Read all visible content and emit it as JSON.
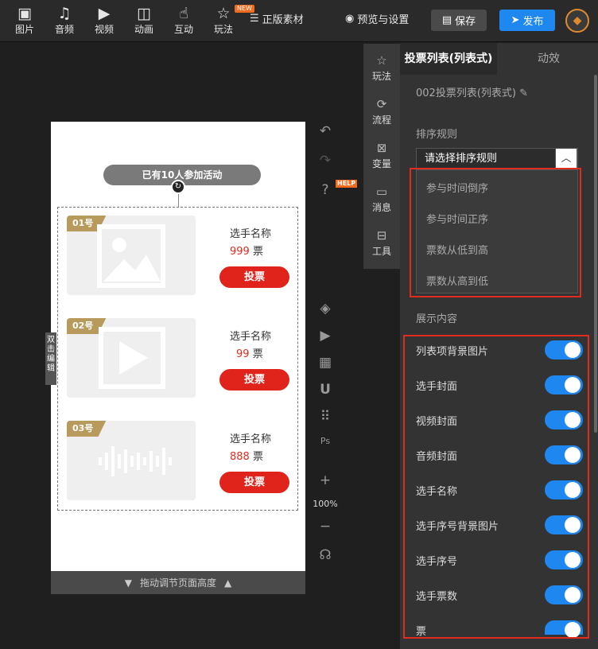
{
  "toolbar": {
    "items": [
      "图片",
      "音频",
      "视频",
      "动画",
      "互动",
      "玩法"
    ],
    "new_badge": "NEW",
    "materials": "正版素材",
    "preview": "预览与设置",
    "save": "保存",
    "publish": "发布"
  },
  "canvas": {
    "participants": "已有10人参加活动",
    "players": [
      {
        "num": "01号",
        "name": "选手名称",
        "votes": "999",
        "unit": "票",
        "button": "投票",
        "cover": "image-icon"
      },
      {
        "num": "02号",
        "name": "选手名称",
        "votes": "99",
        "unit": "票",
        "button": "投票",
        "cover": "play-icon"
      },
      {
        "num": "03号",
        "name": "选手名称",
        "votes": "888",
        "unit": "票",
        "button": "投票",
        "cover": "audio-wave-icon"
      }
    ],
    "side_tag": "双击编辑",
    "page_height": "拖动调节页面高度",
    "zoom": "100%",
    "help": "HELP"
  },
  "vertical_tools": [
    "玩法",
    "流程",
    "变量",
    "消息",
    "工具"
  ],
  "panel": {
    "tabs": [
      "投票列表(列表式)",
      "动效"
    ],
    "component_name": "002投票列表(列表式)",
    "sort_title": "排序规则",
    "sort_placeholder": "请选择排序规则",
    "sort_options": [
      "参与时间倒序",
      "参与时间正序",
      "票数从低到高",
      "票数从高到低"
    ],
    "display_title": "展示内容",
    "display_items": [
      {
        "label": "列表项背景图片",
        "on": true
      },
      {
        "label": "选手封面",
        "on": true
      },
      {
        "label": "视频封面",
        "on": true
      },
      {
        "label": "音频封面",
        "on": true
      },
      {
        "label": "选手名称",
        "on": true
      },
      {
        "label": "选手序号背景图片",
        "on": true
      },
      {
        "label": "选手序号",
        "on": true
      },
      {
        "label": "选手票数",
        "on": true
      },
      {
        "label": "票",
        "on": true
      }
    ]
  },
  "colors": {
    "accent": "#1e87f0",
    "vote_red": "#e0241c",
    "badge_gold": "#b89a5c",
    "highlight": "#e02b1f"
  }
}
